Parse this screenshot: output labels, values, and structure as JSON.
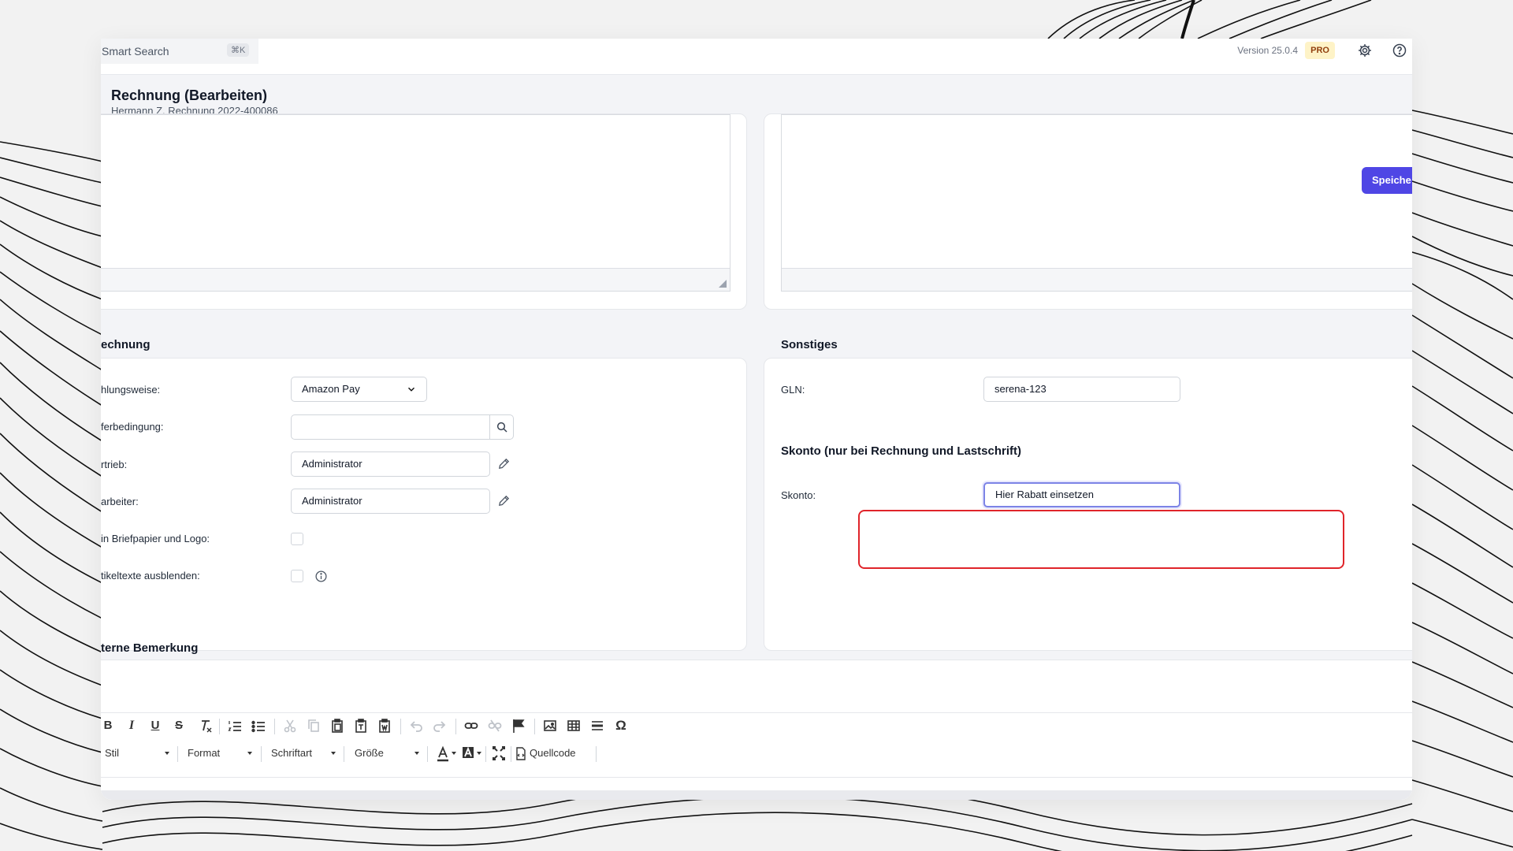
{
  "topbar": {
    "search_label": "Smart Search",
    "search_shortcut": "⌘K",
    "version": "Version 25.0.4",
    "plan_badge": "PRO",
    "settings_icon": "gear-icon",
    "help_icon": "help-icon"
  },
  "header": {
    "title": "Rechnung (Bearbeiten)",
    "subtitle": "Hermann Z. Rechnung 2022-400086"
  },
  "actions": {
    "save_label": "Speiche"
  },
  "rechnung": {
    "section_title": "echnung",
    "fields": {
      "payment_label": "hlungsweise:",
      "payment_value": "Amazon Pay",
      "delivery_label": "ferbedingung:",
      "delivery_value": "",
      "sales_label": "rtrieb:",
      "sales_value": "Administrator",
      "staff_label": "arbeiter:",
      "staff_value": "Administrator",
      "letterhead_label": "in Briefpapier und Logo:",
      "articletext_label": "tikeltexte ausblenden:"
    }
  },
  "sonstiges": {
    "section_title": "Sonstiges",
    "gln_label": "GLN:",
    "gln_value": "serena-123"
  },
  "skonto": {
    "section_title": "Skonto (nur bei Rechnung und Lastschrift)",
    "label": "Skonto:",
    "value": "Hier Rabatt einsetzen"
  },
  "remarks": {
    "section_title": "terne Bemerkung",
    "toolbar": {
      "bold": "B",
      "italic": "I",
      "underline": "U",
      "strike": "S",
      "style_label": "Stil",
      "format_label": "Format",
      "font_label": "Schriftart",
      "size_label": "Größe",
      "source_label": "Quellcode",
      "omega": "Ω"
    }
  }
}
